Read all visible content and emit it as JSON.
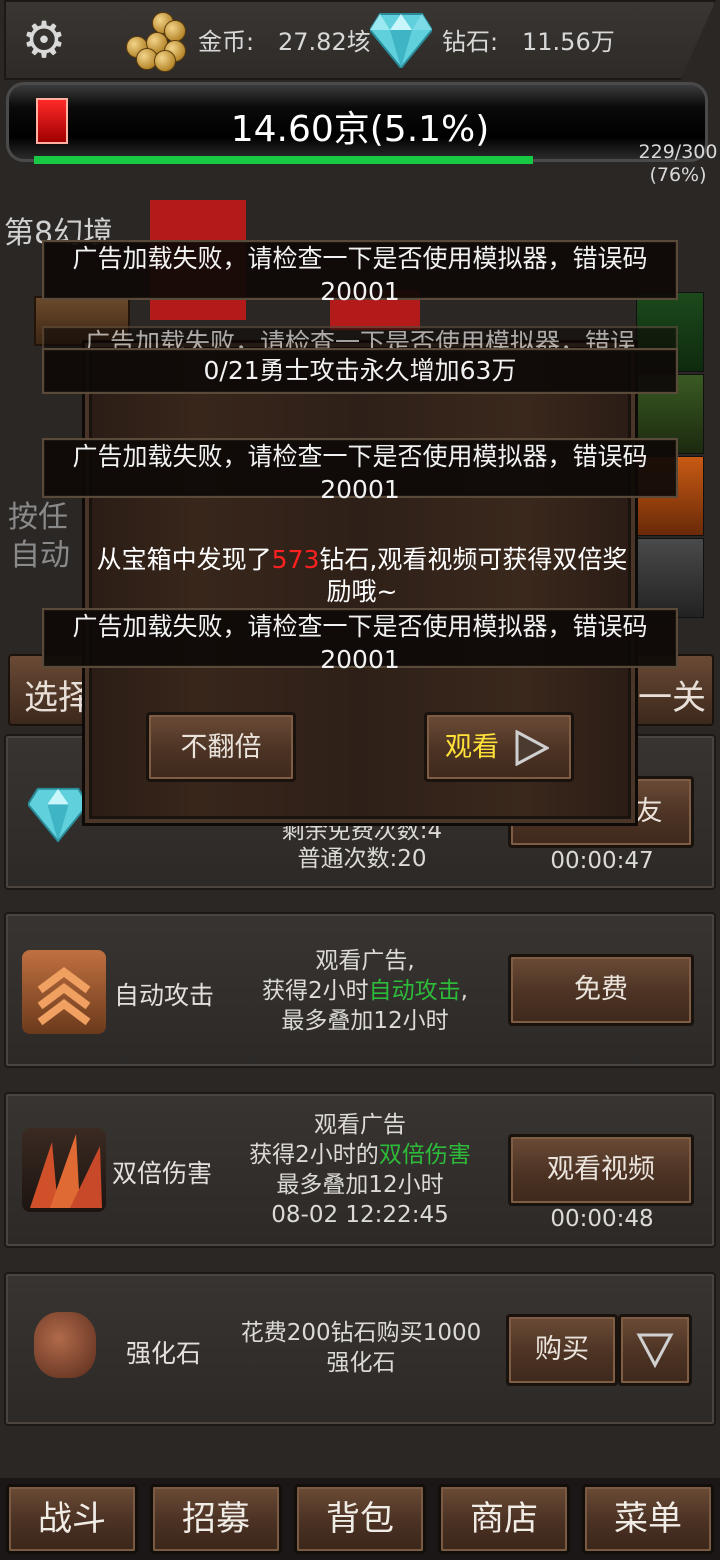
{
  "topbar": {
    "settings_icon": "gear-icon",
    "gold_icon": "gold-coins-icon",
    "gold_label": "金币:",
    "gold_value": "27.82垓",
    "diamond_icon": "diamond-icon",
    "diamond_label": "钻石:",
    "diamond_value": "11.56万"
  },
  "boss": {
    "hp_text": "14.60京(5.1%)",
    "hp_progress_fraction": 0.78,
    "kill_count": "229/300",
    "kill_percent": "(76%)"
  },
  "background": {
    "stage_label": "第8幻境",
    "hint_line1": "按任",
    "hint_line2": "自动",
    "select_btn": "选择",
    "next_btn": "一关"
  },
  "toasts": {
    "ad_error": "广告加载失败，请检查一下是否使用模拟器，错误码20001",
    "ad_error_partial": "广告加载失败，请检查一下是否使用模拟器，错误",
    "warrior_boost": "0/21勇士攻击永久增加63万"
  },
  "popup": {
    "msg_prefix": "从宝箱中发现了",
    "msg_amount": "573",
    "msg_suffix": "钻石,观看视频可获得双倍奖励哦~",
    "no_double_label": "不翻倍",
    "watch_label": "观看"
  },
  "shop": {
    "row1": {
      "remaining_label": "剩余免费次数:4",
      "normal_label": "普通次数:20",
      "button_label": "友",
      "timer": "00:00:47"
    },
    "row2": {
      "name": "自动攻击",
      "desc_line1": "观看广告,",
      "desc_line2_prefix": "获得2小时",
      "desc_line2_green": "自动攻击",
      "desc_line2_suffix": ",",
      "desc_line3": "最多叠加12小时",
      "button_label": "免费"
    },
    "row3": {
      "name": "双倍伤害",
      "desc_line1": "观看广告",
      "desc_line2_prefix": "获得2小时的",
      "desc_line2_green": "双倍伤害",
      "desc_line3": "最多叠加12小时",
      "desc_line4": "08-02  12:22:45",
      "button_label": "观看视频",
      "timer": "00:00:48"
    },
    "row4": {
      "name": "强化石",
      "desc_line1": "花费200钻石购买1000",
      "desc_line2": "强化石",
      "button_label": "购买"
    }
  },
  "nav": {
    "battle": "战斗",
    "recruit": "招募",
    "backpack": "背包",
    "shop": "商店",
    "menu": "菜单"
  }
}
